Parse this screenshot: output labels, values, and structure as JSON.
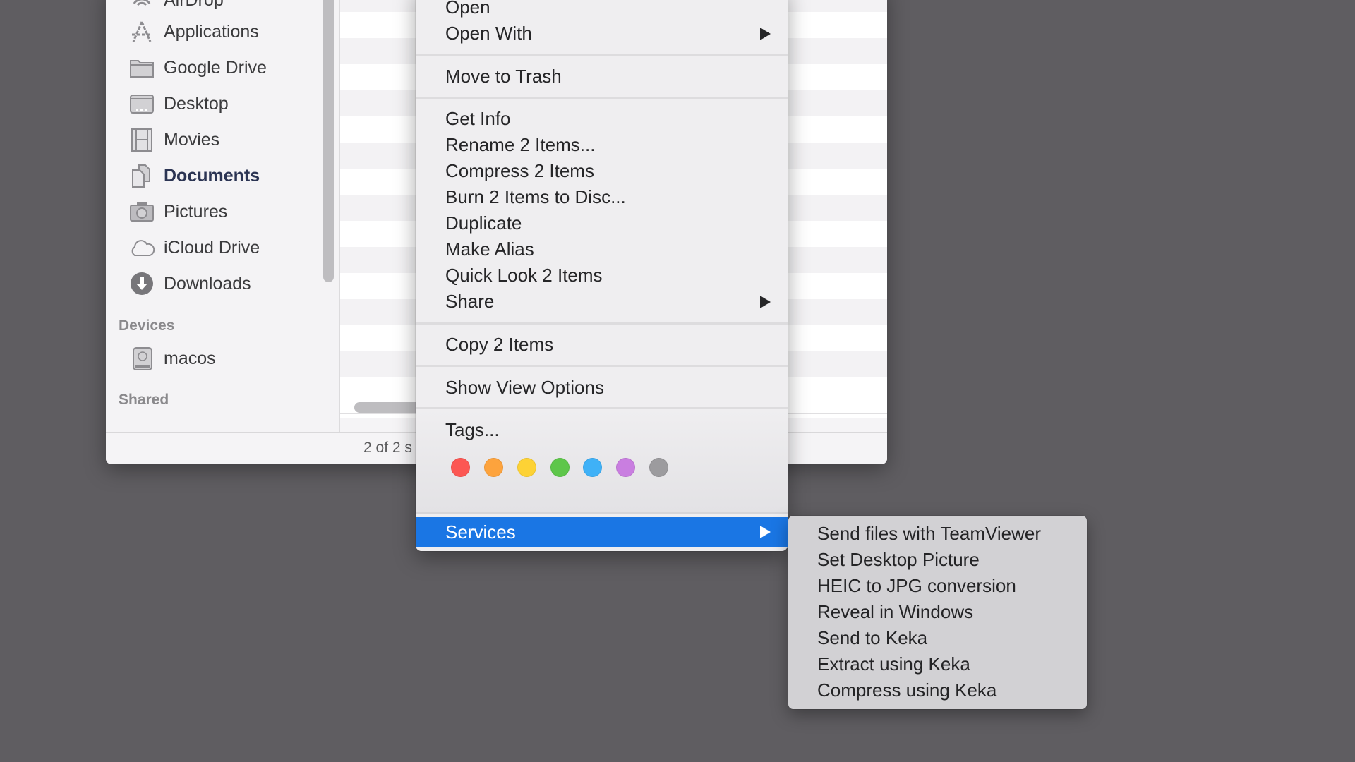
{
  "finder": {
    "sidebar": {
      "favorites": [
        {
          "label": "AirDrop",
          "icon": "airdrop-icon"
        },
        {
          "label": "Applications",
          "icon": "applications-icon"
        },
        {
          "label": "Google Drive",
          "icon": "folder-icon"
        },
        {
          "label": "Desktop",
          "icon": "desktop-icon"
        },
        {
          "label": "Movies",
          "icon": "movies-icon"
        },
        {
          "label": "Documents",
          "icon": "documents-icon",
          "active": true
        },
        {
          "label": "Pictures",
          "icon": "camera-icon"
        },
        {
          "label": "iCloud Drive",
          "icon": "cloud-icon"
        },
        {
          "label": "Downloads",
          "icon": "download-icon"
        }
      ],
      "devices_header": "Devices",
      "devices": [
        {
          "label": "macos",
          "icon": "hard-drive-icon"
        }
      ],
      "shared_header": "Shared"
    },
    "status_text": "2 of 2 s"
  },
  "context_menu": {
    "items": [
      {
        "label": "Open"
      },
      {
        "label": "Open With",
        "submenu": true
      },
      {
        "label": "Move to Trash"
      },
      {
        "label": "Get Info"
      },
      {
        "label": "Rename 2 Items..."
      },
      {
        "label": "Compress 2 Items"
      },
      {
        "label": "Burn 2 Items to Disc..."
      },
      {
        "label": "Duplicate"
      },
      {
        "label": "Make Alias"
      },
      {
        "label": "Quick Look 2 Items"
      },
      {
        "label": "Share",
        "submenu": true
      },
      {
        "label": "Copy 2 Items"
      },
      {
        "label": "Show View Options"
      },
      {
        "label": "Tags..."
      },
      {
        "label": "Services",
        "submenu": true,
        "highlighted": true
      }
    ],
    "tag_colors": [
      {
        "name": "Red",
        "color": "#fc5753"
      },
      {
        "name": "Orange",
        "color": "#fda33d"
      },
      {
        "name": "Yellow",
        "color": "#fdd235"
      },
      {
        "name": "Green",
        "color": "#5ec64a"
      },
      {
        "name": "Blue",
        "color": "#3fb1f7"
      },
      {
        "name": "Purple",
        "color": "#c97ee0"
      },
      {
        "name": "Gray",
        "color": "#9c9b9e"
      }
    ],
    "highlight_color": "#1a76e4"
  },
  "services_submenu": {
    "items": [
      {
        "label": "Send files with TeamViewer"
      },
      {
        "label": "Set Desktop Picture"
      },
      {
        "label": "HEIC to JPG conversion"
      },
      {
        "label": "Reveal in Windows"
      },
      {
        "label": "Send to Keka"
      },
      {
        "label": "Extract using Keka"
      },
      {
        "label": "Compress using Keka"
      }
    ]
  }
}
